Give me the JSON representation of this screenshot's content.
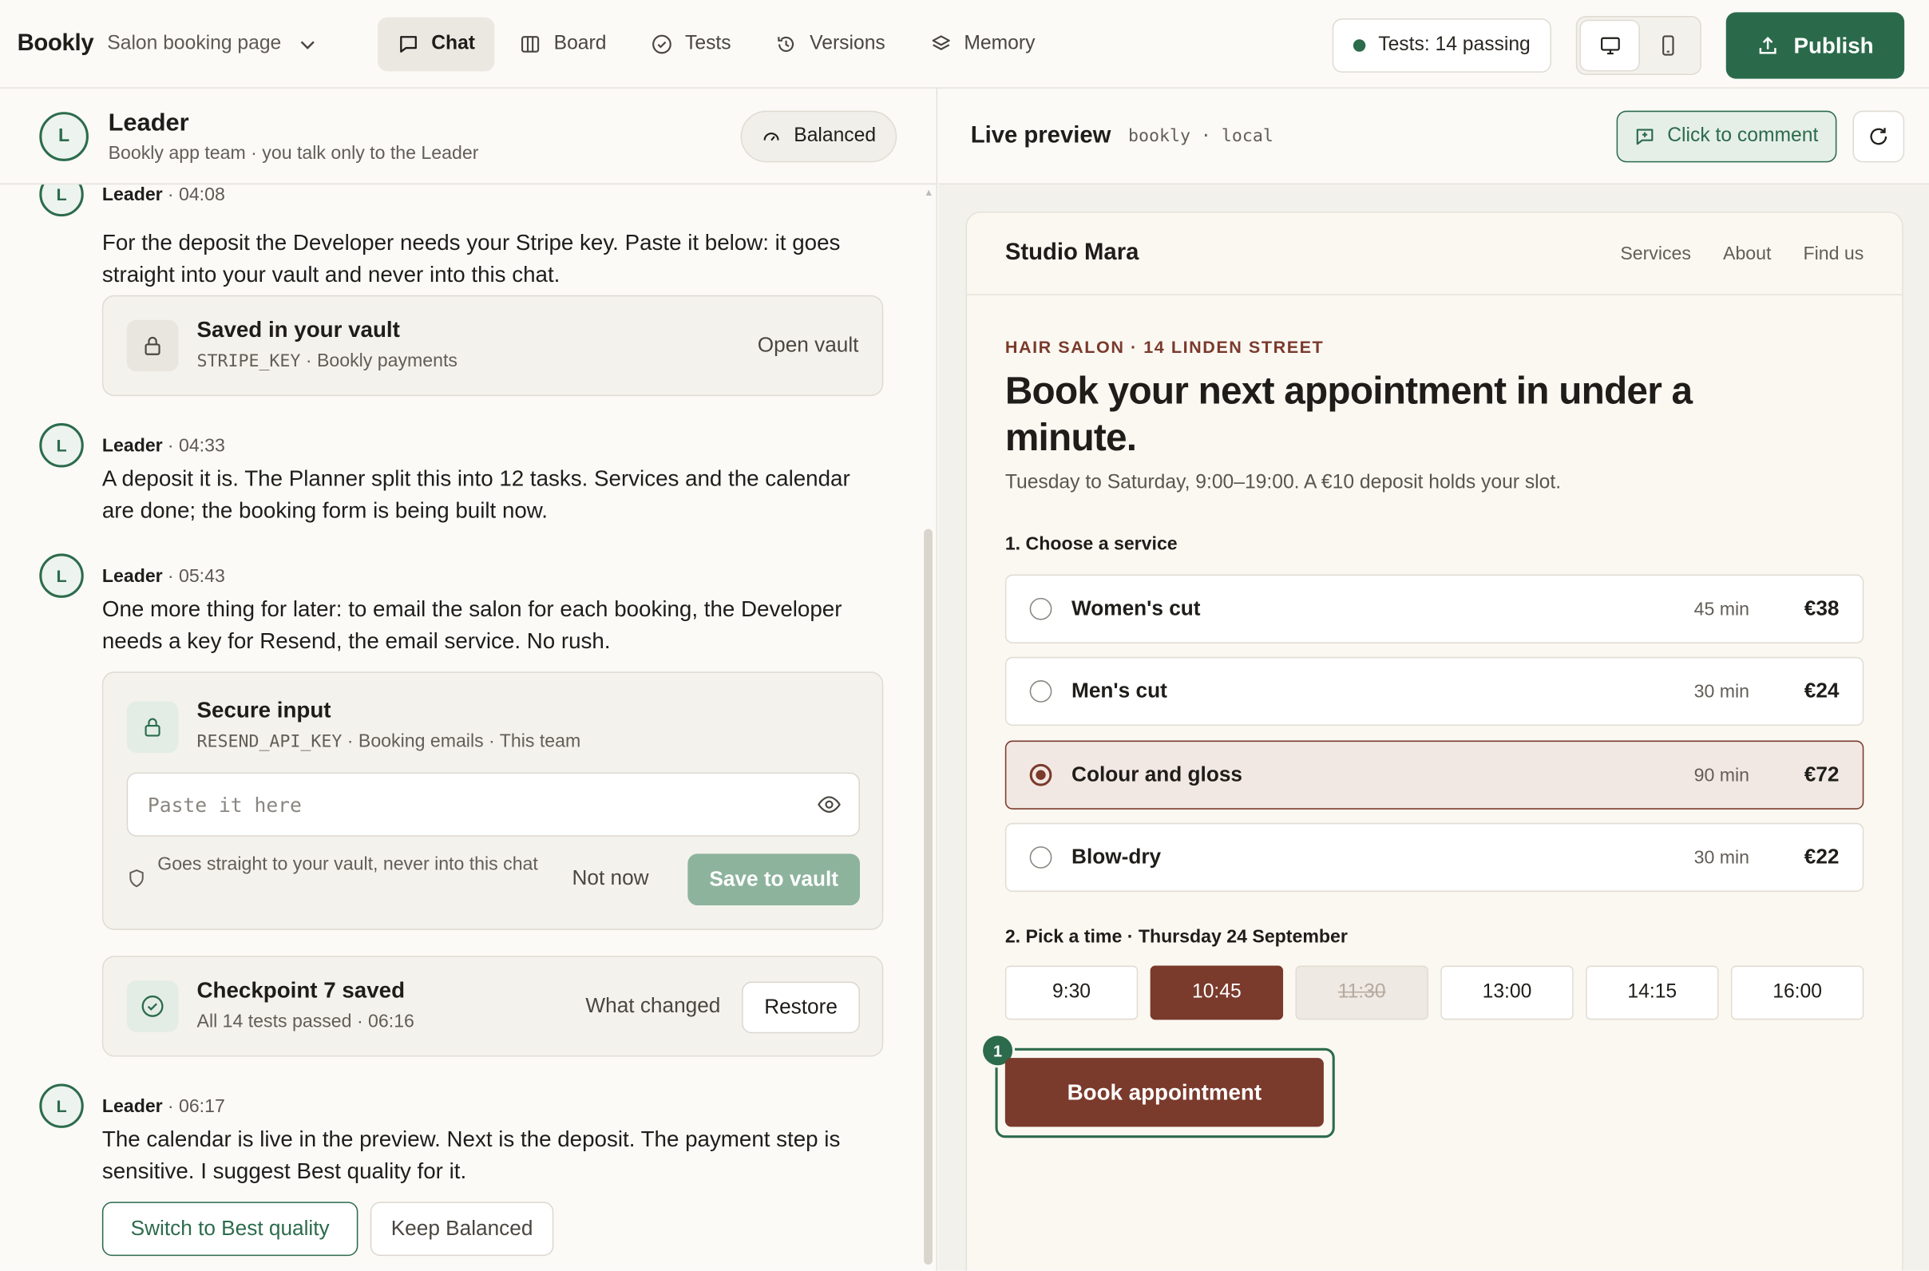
{
  "topbar": {
    "brand": "Bookly",
    "project": "Salon booking page",
    "tabs": [
      {
        "label": "Chat",
        "icon": "chat-icon"
      },
      {
        "label": "Board",
        "icon": "board-icon"
      },
      {
        "label": "Tests",
        "icon": "check-circle-icon"
      },
      {
        "label": "Versions",
        "icon": "history-icon"
      },
      {
        "label": "Memory",
        "icon": "layers-icon"
      }
    ],
    "tests_status": "Tests: 14 passing",
    "publish_label": "Publish",
    "colors": {
      "accent": "#2a6a4b",
      "brand_site": "#7a3a2c"
    }
  },
  "leader": {
    "avatar": "L",
    "name": "Leader",
    "subtitle": "Bookly app team · you talk only to the Leader",
    "mode": "Balanced"
  },
  "chat": {
    "messages": [
      {
        "author": "Leader",
        "time": "· 04:08",
        "text": "For the deposit the Developer needs your Stripe key. Paste it below: it goes straight into your vault and never into this chat."
      },
      {
        "author": "Leader",
        "time": "· 04:33",
        "text": "A deposit it is. The Planner split this into 12 tasks. Services and the calendar are done; the booking form is being built now."
      },
      {
        "author": "Leader",
        "time": "· 05:43",
        "text": "One more thing for later: to email the salon for each booking, the Developer needs a key for Resend, the email service. No rush."
      },
      {
        "author": "Leader",
        "time": "· 06:17",
        "text": "The calendar is live in the preview. Next is the deposit. The payment step is sensitive. I suggest Best quality for it."
      }
    ],
    "vault_card": {
      "title": "Saved in your vault",
      "key": "STRIPE_KEY",
      "sub": " · Bookly payments",
      "action": "Open vault"
    },
    "secure_card": {
      "title": "Secure input",
      "key": "RESEND_API_KEY",
      "sub": " · Booking emails · This team",
      "placeholder": "Paste it here",
      "note": "Goes straight to your vault, never into this chat",
      "not_now": "Not now",
      "save": "Save to vault"
    },
    "checkpoint_card": {
      "title": "Checkpoint 7 saved",
      "sub": "All 14 tests passed · 06:16",
      "what_changed": "What changed",
      "restore": "Restore"
    },
    "actions": {
      "best": "Switch to Best quality",
      "keep": "Keep Balanced"
    }
  },
  "preview": {
    "title": "Live preview",
    "url": "bookly · local",
    "comment": "Click to comment"
  },
  "site": {
    "brand": "Studio Mara",
    "links": [
      "Services",
      "About",
      "Find us"
    ],
    "eyebrow": "HAIR SALON · 14 LINDEN STREET",
    "headline": "Book your next appointment in under a minute.",
    "sub": "Tuesday to Saturday, 9:00–19:00. A €10 deposit holds your slot.",
    "step1": "1. Choose a service",
    "services": [
      {
        "name": "Women's cut",
        "duration": "45 min",
        "price": "€38",
        "selected": false
      },
      {
        "name": "Men's cut",
        "duration": "30 min",
        "price": "€24",
        "selected": false
      },
      {
        "name": "Colour and gloss",
        "duration": "90 min",
        "price": "€72",
        "selected": true
      },
      {
        "name": "Blow-dry",
        "duration": "30 min",
        "price": "€22",
        "selected": false
      }
    ],
    "step2": "2. Pick a time · Thursday 24 September",
    "slots": [
      {
        "time": "9:30",
        "state": "open"
      },
      {
        "time": "10:45",
        "state": "selected"
      },
      {
        "time": "11:30",
        "state": "unavailable"
      },
      {
        "time": "13:00",
        "state": "open"
      },
      {
        "time": "14:15",
        "state": "open"
      },
      {
        "time": "16:00",
        "state": "open"
      }
    ],
    "book": "Book appointment",
    "comment_pin": "1"
  }
}
